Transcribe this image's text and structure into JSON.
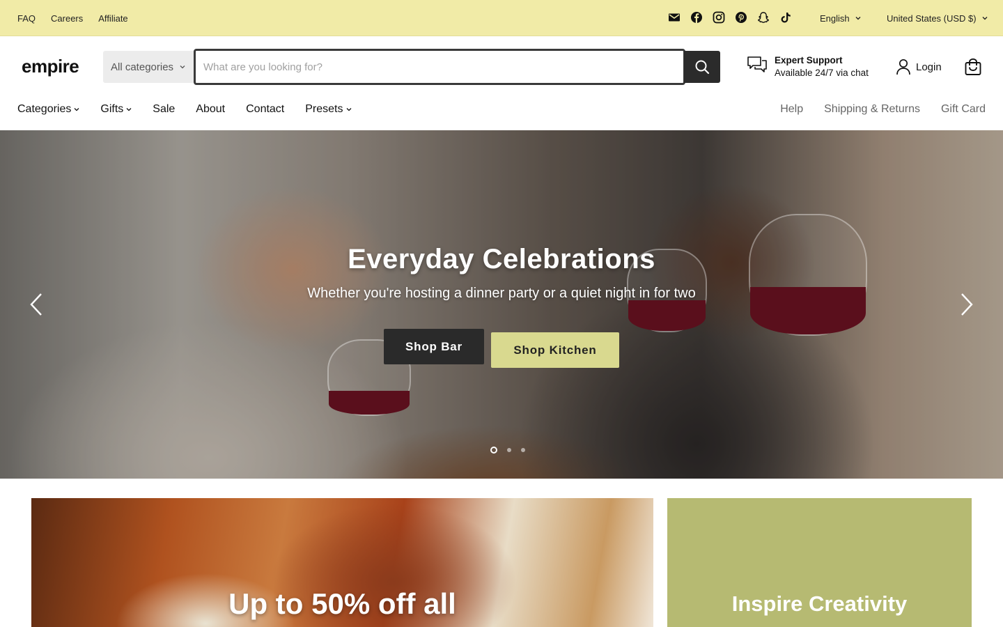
{
  "utility": {
    "links": [
      "FAQ",
      "Careers",
      "Affiliate"
    ],
    "social_icons": [
      "mail-icon",
      "facebook-icon",
      "instagram-icon",
      "pinterest-icon",
      "snapchat-icon",
      "tiktok-icon"
    ],
    "language": "English",
    "currency": "United States (USD $)"
  },
  "header": {
    "logo": "empire",
    "search_category": "All categories",
    "search_placeholder": "What are you looking for?",
    "support_title": "Expert Support",
    "support_subtitle": "Available 24/7 via chat",
    "login_label": "Login"
  },
  "nav": {
    "left": [
      "Categories",
      "Gifts",
      "Sale",
      "About",
      "Contact",
      "Presets"
    ],
    "right": [
      "Help",
      "Shipping & Returns",
      "Gift Card"
    ]
  },
  "hero": {
    "title": "Everyday Celebrations",
    "subtitle": "Whether you're hosting a dinner party or a quiet night in for two",
    "button_primary": "Shop Bar",
    "button_secondary": "Shop Kitchen",
    "slide_count": 3,
    "active_slide": 1
  },
  "promos": {
    "left_title": "Up to 50% off all",
    "right_title": "Inspire Creativity"
  },
  "colors": {
    "utility_bar": "#f1eba7",
    "accent_button": "#d9d98f",
    "promo_green": "#b6ba72",
    "dark_button": "#2a2a2a"
  }
}
